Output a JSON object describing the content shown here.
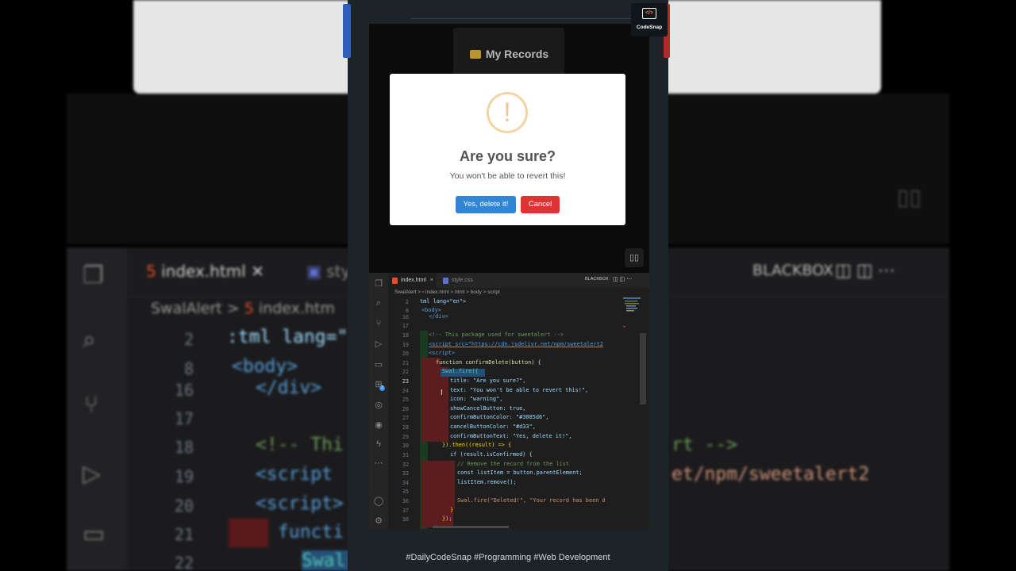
{
  "background": {
    "tabs": [
      "index.html",
      "sty"
    ],
    "breadcrumb": [
      "SwalAlert",
      "index.htm"
    ],
    "line_numbers": [
      "2",
      "8",
      "16",
      "17",
      "18",
      "19",
      "20",
      "21",
      "22"
    ],
    "code_lines": [
      ":tml lang=\"",
      "<body>",
      "</div>",
      "",
      "<!-- Thi",
      "<script",
      "<script>",
      "functi",
      "Swal"
    ],
    "right_code_lines": [
      "rt -->",
      "et/npm/sweetalert2"
    ],
    "blackbox_label": "BLACKBOX"
  },
  "codesnap": {
    "label": "CodeSnap"
  },
  "app": {
    "title": "My Records",
    "icons": {
      "folder": "folder-icon",
      "dock": "layout-icon"
    }
  },
  "modal": {
    "icon": "!",
    "title": "Are you sure?",
    "text": "You won't be able to revert this!",
    "confirm_label": "Yes, delete it!",
    "cancel_label": "Cancel",
    "confirm_color": "#3085d6",
    "cancel_color": "#dd3333"
  },
  "editor": {
    "tabs": [
      {
        "label": "index.html",
        "close": "×",
        "active": true
      },
      {
        "label": "style.css",
        "active": false
      }
    ],
    "blackbox_label": "BLACKBOX",
    "breadcrumb": [
      "SwalAlert",
      "index.html",
      "html",
      "body",
      "script"
    ],
    "lines": [
      {
        "n": "2",
        "code": "tml lang=\"en\">"
      },
      {
        "n": "8",
        "code": "<body>"
      },
      {
        "n": "16",
        "code": "</div>"
      },
      {
        "n": "17",
        "code": ""
      },
      {
        "n": "18",
        "code": "<!-- This package used for sweetalert -->"
      },
      {
        "n": "19",
        "code": "<script src=\"https://cdn.jsdelivr.net/npm/sweetalert2"
      },
      {
        "n": "20",
        "code": "<script>"
      },
      {
        "n": "21",
        "code": "function confirmDelete(button) {"
      },
      {
        "n": "22",
        "code": "Swal.fire({"
      },
      {
        "n": "23",
        "code": "title: \"Are you sure?\","
      },
      {
        "n": "24",
        "code": "text: \"You won't be able to revert this!\","
      },
      {
        "n": "25",
        "code": "icon: \"warning\","
      },
      {
        "n": "26",
        "code": "showCancelButton: true,"
      },
      {
        "n": "27",
        "code": "confirmButtonColor: \"#3085d6\","
      },
      {
        "n": "28",
        "code": "cancelButtonColor: \"#d33\","
      },
      {
        "n": "29",
        "code": "confirmButtonText: \"Yes, delete it!\","
      },
      {
        "n": "30",
        "code": "}).then((result) => {"
      },
      {
        "n": "31",
        "code": "if (result.isConfirmed) {"
      },
      {
        "n": "32",
        "code": "// Remove the record from the list"
      },
      {
        "n": "33",
        "code": "const listItem = button.parentElement;"
      },
      {
        "n": "34",
        "code": "listItem.remove();"
      },
      {
        "n": "35",
        "code": ""
      },
      {
        "n": "36",
        "code": "Swal.fire(\"Deleted!\", \"Your record has been d"
      },
      {
        "n": "37",
        "code": "}"
      },
      {
        "n": "38",
        "code": "});"
      }
    ]
  },
  "footer": {
    "hashtags": "#DailyCodeSnap #Programming #Web Development"
  }
}
